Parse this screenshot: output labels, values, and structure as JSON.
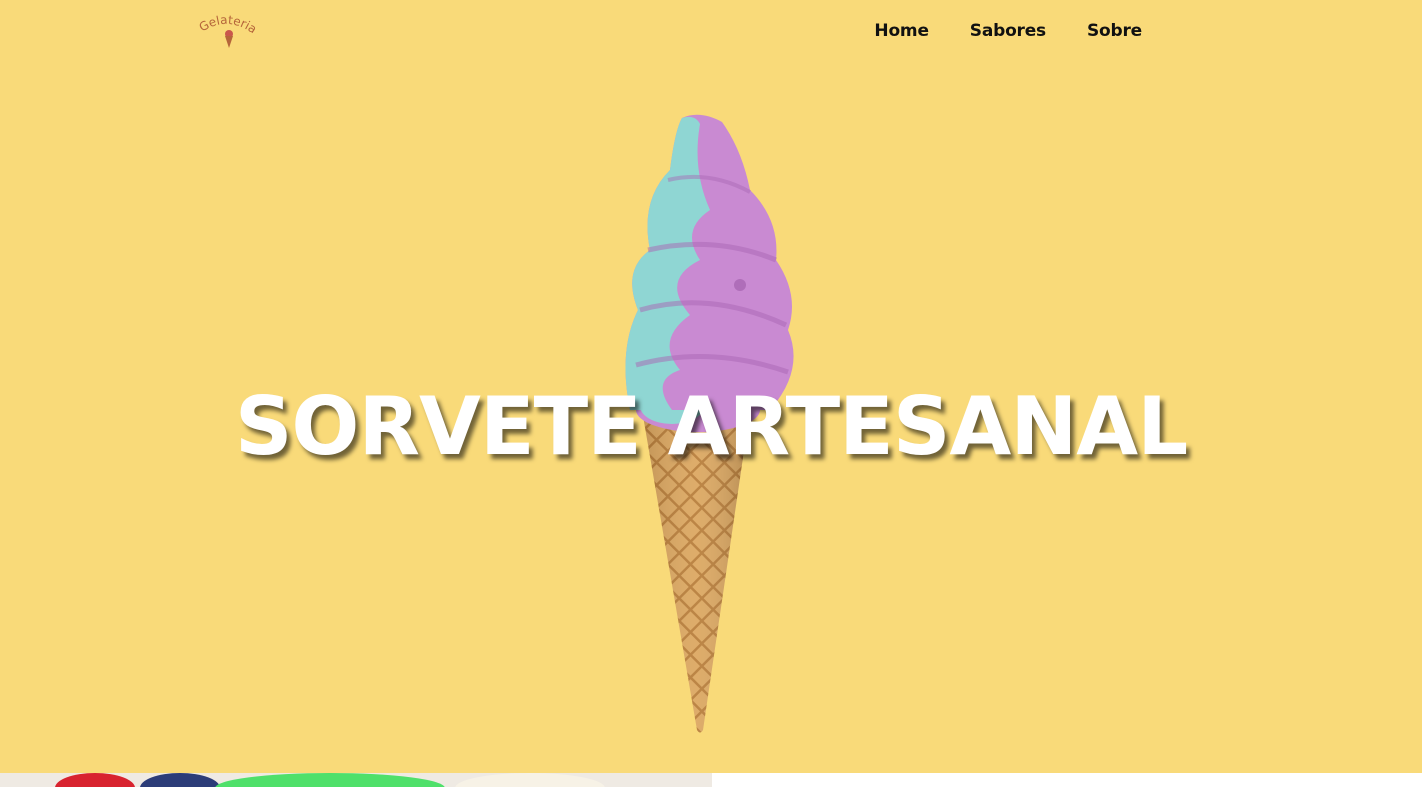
{
  "header": {
    "logo_text": "Gelateria",
    "nav": [
      {
        "label": "Home"
      },
      {
        "label": "Sabores"
      },
      {
        "label": "Sobre"
      }
    ]
  },
  "hero": {
    "title": "SORVETE ARTESANAL",
    "image": "soft-serve-ice-cream-cone-icon"
  },
  "colors": {
    "background": "#f9da79",
    "title": "#ffffff",
    "nav_text": "#111111",
    "cone": "#d9a45b",
    "cream_pink": "#c98ad2",
    "cream_teal": "#8fd6d3"
  }
}
